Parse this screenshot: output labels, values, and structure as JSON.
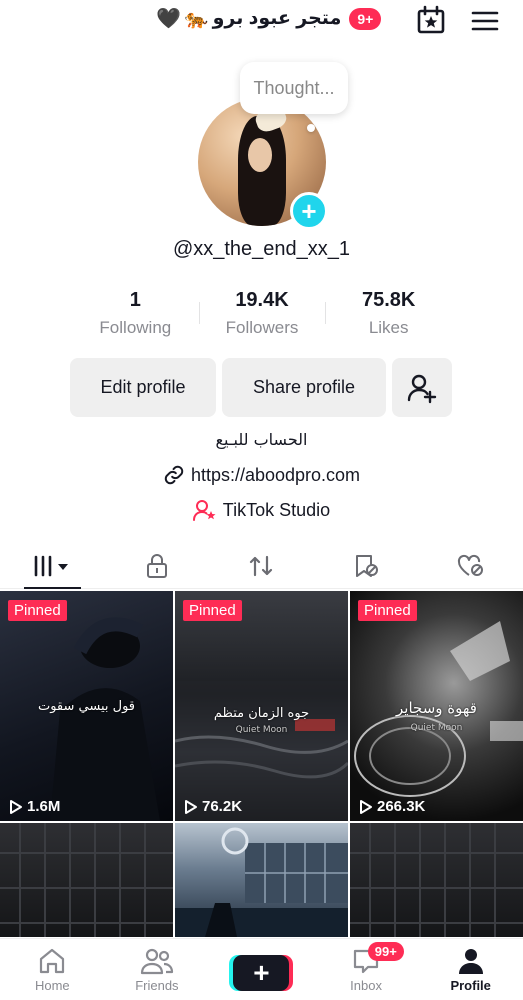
{
  "header": {
    "title": "متجر عبود برو",
    "title_emoji_heart": "🖤",
    "title_emoji_tiger": "🐅",
    "notification_badge": "9+"
  },
  "thought_bubble": {
    "text": "Thought..."
  },
  "profile": {
    "username": "@xx_the_end_xx_1",
    "bio": "الحساب للبـيع",
    "link": "https://aboodpro.com",
    "studio_label": "TikTok Studio"
  },
  "stats": [
    {
      "value": "1",
      "label": "Following"
    },
    {
      "value": "19.4K",
      "label": "Followers"
    },
    {
      "value": "75.8K",
      "label": "Likes"
    }
  ],
  "actions": {
    "edit_label": "Edit profile",
    "share_label": "Share profile"
  },
  "videos": [
    {
      "pinned": "Pinned",
      "views": "1.6M",
      "caption": "قول بيسي سقوت"
    },
    {
      "pinned": "Pinned",
      "views": "76.2K",
      "caption": "جوه الزمان متظم"
    },
    {
      "pinned": "Pinned",
      "views": "266.3K",
      "caption": "قهوة وسجاير"
    }
  ],
  "video_watermark": "Quiet Moon",
  "nav": {
    "home": "Home",
    "friends": "Friends",
    "inbox": "Inbox",
    "inbox_badge": "99+",
    "profile": "Profile"
  },
  "colors": {
    "accent": "#fe2c55",
    "cyan": "#20d5ec",
    "text": "#161823",
    "muted": "#8a8b91"
  }
}
